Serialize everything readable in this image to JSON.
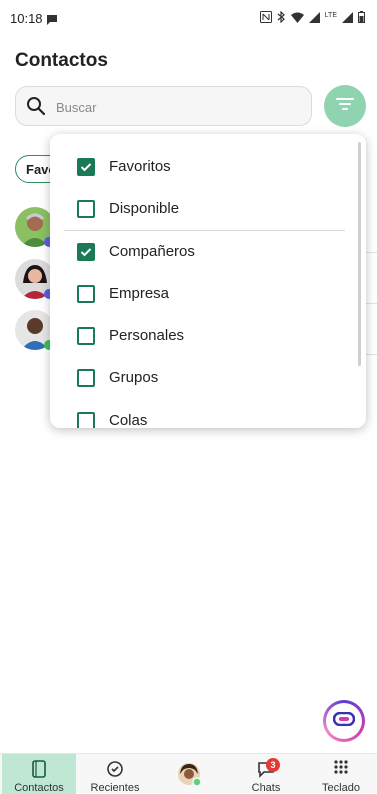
{
  "status_bar": {
    "time": "10:18",
    "network_label": "LTE"
  },
  "header": {
    "title": "Contactos"
  },
  "search": {
    "placeholder": "Buscar",
    "value": ""
  },
  "chip": {
    "label": "Favoritos"
  },
  "filter_menu": {
    "items": [
      {
        "label": "Favoritos",
        "checked": true
      },
      {
        "label": "Disponible",
        "checked": false
      },
      {
        "label": "Compañeros",
        "checked": true
      },
      {
        "label": "Empresa",
        "checked": false
      },
      {
        "label": "Personales",
        "checked": false
      },
      {
        "label": "Grupos",
        "checked": false
      },
      {
        "label": "Colas",
        "checked": false
      }
    ]
  },
  "bottom_nav": {
    "items": [
      {
        "label": "Contactos",
        "icon": "contacts-icon",
        "active": true
      },
      {
        "label": "Recientes",
        "icon": "recents-icon",
        "active": false
      },
      {
        "label": "",
        "icon": "profile-avatar",
        "active": false
      },
      {
        "label": "Chats",
        "icon": "chat-icon",
        "active": false,
        "badge": "3"
      },
      {
        "label": "Teclado",
        "icon": "dialpad-icon",
        "active": false
      }
    ]
  },
  "colors": {
    "accent": "#1a7a55",
    "filter_button": "#8fd3b1",
    "nav_active": "#bfe7d3",
    "badge": "#e53935"
  }
}
